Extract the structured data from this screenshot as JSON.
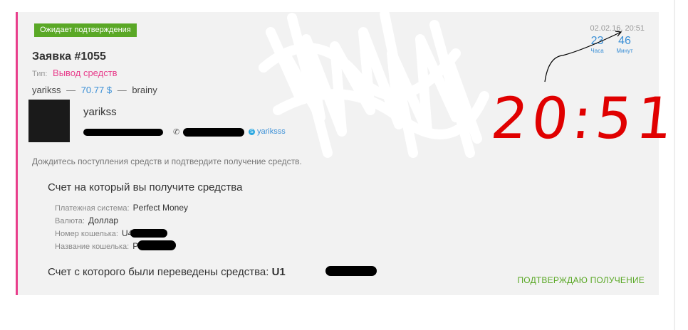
{
  "status_badge": "Ожидает подтверждения",
  "order": {
    "title": "Заявка #1055",
    "type_label": "Тип:",
    "type_value": "Вывод средств"
  },
  "transfer": {
    "from_user": "yarikss",
    "amount": "70.77 $",
    "to_user": "brainy",
    "dash": "—"
  },
  "user": {
    "name": "yarikss",
    "skype": "yariksss"
  },
  "note": "Дождитесь поступления средств и подтвердите получение средств.",
  "receive_section": {
    "title": "Счет на который вы получите средства",
    "rows": [
      {
        "label": "Платежная система:",
        "value": "Perfect Money"
      },
      {
        "label": "Валюта:",
        "value": "Доллар"
      },
      {
        "label": "Номер кошелька:",
        "value": "U4"
      },
      {
        "label": "Название кошелька:",
        "value": "P"
      }
    ]
  },
  "from_account": {
    "label": "Счет с которого были переведены средства:",
    "value": "U1"
  },
  "confirm_label": "ПОДТВЕРЖДАЮ ПОЛУЧЕНИЕ",
  "timer": {
    "date": "02.02.16, 20:51",
    "hours": "23",
    "hours_label": "Часа",
    "minutes": "46",
    "minutes_label": "Минут"
  },
  "annotation_time": "20:51",
  "colors": {
    "accent_pink": "#e83e8c",
    "badge_green": "#5aa826",
    "link_blue": "#3a8fd6",
    "annotation_red": "#e00000"
  }
}
